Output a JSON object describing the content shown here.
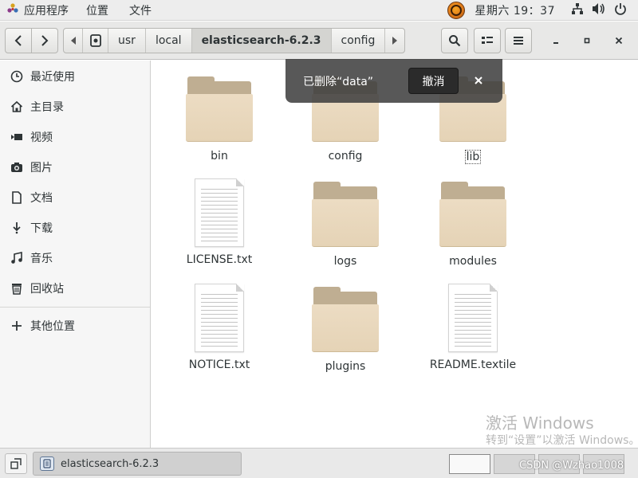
{
  "top_panel": {
    "apps_label": "应用程序",
    "places_label": "位置",
    "files_label": "文件",
    "clock": "星期六 19：37"
  },
  "header": {
    "path": [
      "usr",
      "local",
      "elasticsearch-6.2.3",
      "config"
    ],
    "active_segment": "elasticsearch-6.2.3"
  },
  "sidebar": {
    "items": [
      {
        "label": "最近使用",
        "icon": "clock-icon"
      },
      {
        "label": "主目录",
        "icon": "home-icon"
      },
      {
        "label": "视频",
        "icon": "video-icon"
      },
      {
        "label": "图片",
        "icon": "camera-icon"
      },
      {
        "label": "文档",
        "icon": "document-icon"
      },
      {
        "label": "下载",
        "icon": "download-icon"
      },
      {
        "label": "音乐",
        "icon": "music-icon"
      },
      {
        "label": "回收站",
        "icon": "trash-icon"
      },
      {
        "label": "其他位置",
        "icon": "plus-icon"
      }
    ]
  },
  "files": [
    {
      "name": "bin",
      "type": "folder"
    },
    {
      "name": "config",
      "type": "folder"
    },
    {
      "name": "lib",
      "type": "folder"
    },
    {
      "name": "LICENSE.txt",
      "type": "text"
    },
    {
      "name": "logs",
      "type": "folder"
    },
    {
      "name": "modules",
      "type": "folder"
    },
    {
      "name": "NOTICE.txt",
      "type": "text"
    },
    {
      "name": "plugins",
      "type": "folder"
    },
    {
      "name": "README.textile",
      "type": "text"
    }
  ],
  "toast": {
    "message": "已删除“data”",
    "undo_label": "撤消"
  },
  "watermark": {
    "line1": "激活 Windows",
    "line2": "转到“设置”以激活 Windows。"
  },
  "taskbar": {
    "task_label": "elasticsearch-6.2.3",
    "credit": "CSDN @Wzhao1008"
  },
  "colors": {
    "folder_back": "#bfae92",
    "folder_front": "#e5d3b6",
    "toast_bg": "#3c3c3c"
  }
}
